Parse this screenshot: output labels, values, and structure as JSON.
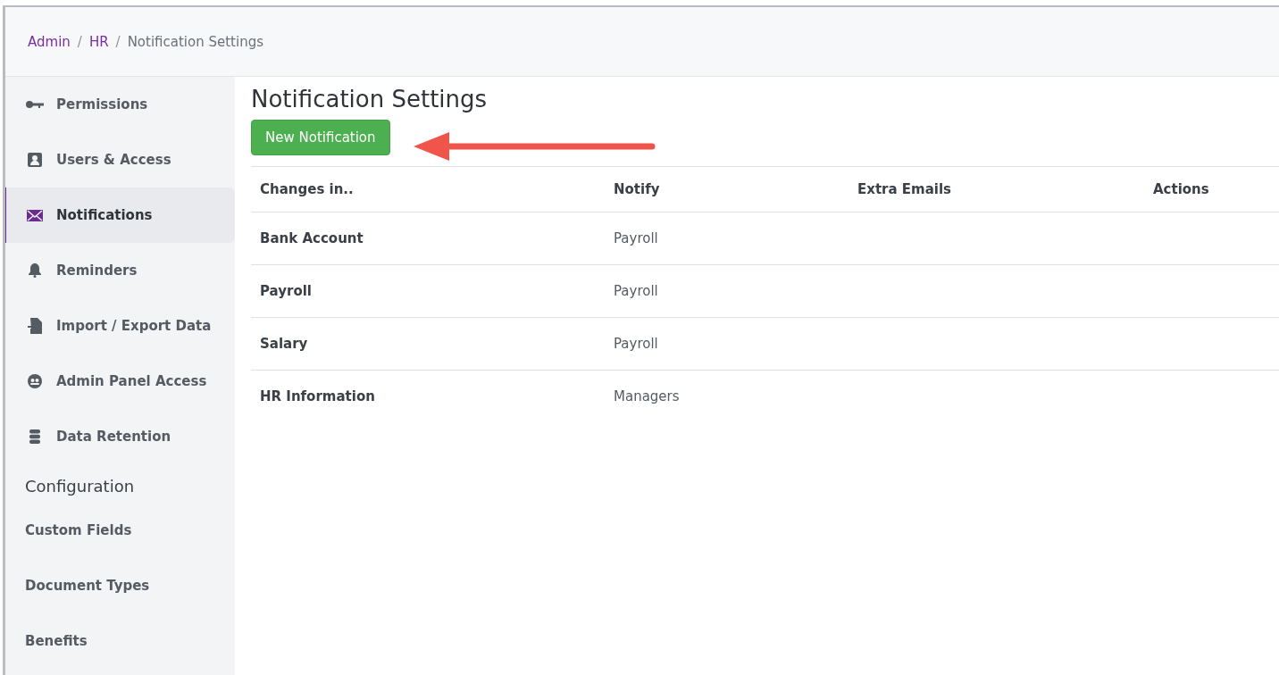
{
  "breadcrumb": {
    "links": [
      "Admin",
      "HR"
    ],
    "separator": "/",
    "current": "Notification Settings"
  },
  "sidebar": {
    "items": [
      {
        "kind": "item",
        "label": "Permissions",
        "selected": false
      },
      {
        "kind": "item",
        "label": "Users & Access",
        "selected": false
      },
      {
        "kind": "item",
        "label": "Notifications",
        "selected": true
      },
      {
        "kind": "item",
        "label": "Reminders",
        "selected": false
      },
      {
        "kind": "item",
        "label": "Import / Export Data",
        "selected": false
      },
      {
        "kind": "item",
        "label": "Admin Panel Access",
        "selected": false
      },
      {
        "kind": "item",
        "label": "Data Retention",
        "selected": false
      },
      {
        "kind": "heading",
        "label": "Configuration"
      },
      {
        "kind": "plain",
        "label": "Custom Fields",
        "selected": false
      },
      {
        "kind": "plain",
        "label": "Document Types",
        "selected": false
      },
      {
        "kind": "plain",
        "label": "Benefits",
        "selected": false
      }
    ]
  },
  "page": {
    "title": "Notification Settings",
    "button": "New Notification"
  },
  "table": {
    "columns": [
      "Changes in..",
      "Notify",
      "Extra Emails",
      "Actions"
    ],
    "rows": [
      {
        "changes_in": "Bank Account",
        "notify": "Payroll"
      },
      {
        "changes_in": "Payroll",
        "notify": "Payroll"
      },
      {
        "changes_in": "Salary",
        "notify": "Payroll"
      },
      {
        "changes_in": "HR Information",
        "notify": "Managers"
      }
    ]
  }
}
